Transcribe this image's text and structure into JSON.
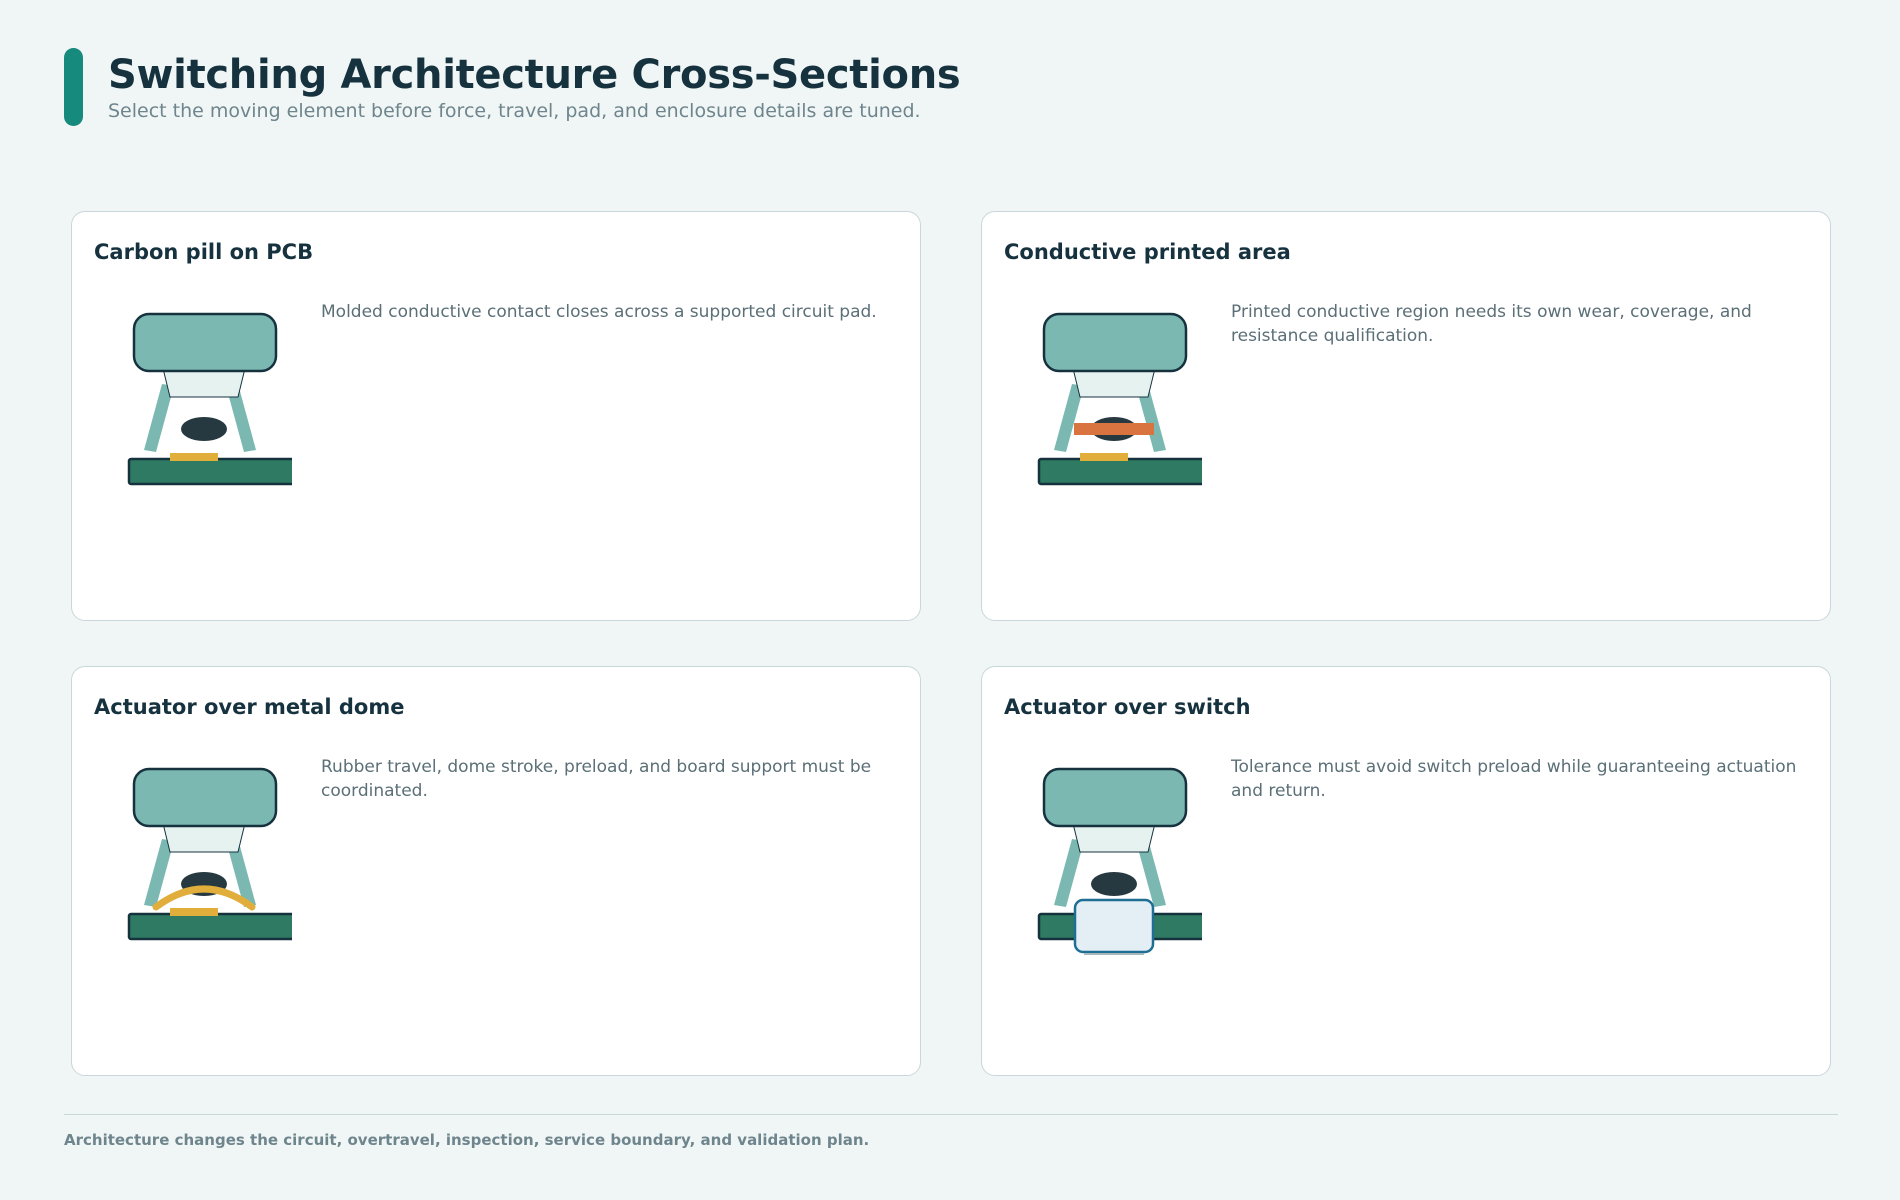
{
  "header": {
    "title": "Switching Architecture Cross-Sections",
    "subtitle": "Select the moving element before force, travel, pad, and enclosure details are tuned."
  },
  "colors": {
    "background": "#f0f6f5",
    "accent": "#168a7c",
    "keycap": "#7bb8b2",
    "outline": "#16323f",
    "pcb": "#2f7a62",
    "gold_pad": "#e1ae3c",
    "carbon_pill": "#263840",
    "printed_area": "#d9733f",
    "switch_body": "#e4eef5"
  },
  "cards": [
    {
      "title": "Carbon pill on PCB",
      "description": "Molded conductive contact closes across a supported circuit pad.",
      "variant": "carbon-pill"
    },
    {
      "title": "Conductive printed area",
      "description": "Printed conductive region needs its own wear, coverage, and resistance qualification.",
      "variant": "printed-area"
    },
    {
      "title": "Actuator over metal dome",
      "description": "Rubber travel, dome stroke, preload, and board support must be coordinated.",
      "variant": "metal-dome"
    },
    {
      "title": "Actuator over switch",
      "description": "Tolerance must avoid switch preload while guaranteeing actuation and return.",
      "variant": "tact-switch"
    }
  ],
  "footer": {
    "note": "Architecture changes the circuit, overtravel, inspection, service boundary, and validation plan."
  }
}
